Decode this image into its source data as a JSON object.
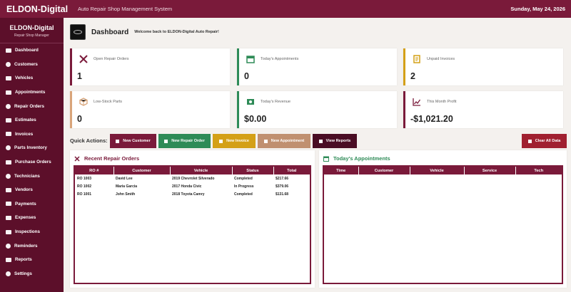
{
  "app": {
    "brand": "ELDON-Digital",
    "subtitle": "Auto Repair Shop Management System",
    "date": "Sunday, May 24, 2026"
  },
  "sidebar": {
    "title": "ELDON-Digital",
    "tagline": "Repair Shop Manager",
    "items": [
      {
        "label": "Dashboard",
        "icon": "dashboard-icon"
      },
      {
        "label": "Customers",
        "icon": "users-icon"
      },
      {
        "label": "Vehicles",
        "icon": "car-icon"
      },
      {
        "label": "Appointments",
        "icon": "calendar-icon"
      },
      {
        "label": "Repair Orders",
        "icon": "wrench-icon"
      },
      {
        "label": "Estimates",
        "icon": "calculator-icon"
      },
      {
        "label": "Invoices",
        "icon": "invoice-icon"
      },
      {
        "label": "Parts Inventory",
        "icon": "gear-icon"
      },
      {
        "label": "Purchase Orders",
        "icon": "cart-icon"
      },
      {
        "label": "Technicians",
        "icon": "technician-icon"
      },
      {
        "label": "Vendors",
        "icon": "truck-icon"
      },
      {
        "label": "Payments",
        "icon": "money-icon"
      },
      {
        "label": "Expenses",
        "icon": "receipt-icon"
      },
      {
        "label": "Inspections",
        "icon": "clipboard-icon"
      },
      {
        "label": "Reminders",
        "icon": "bell-icon"
      },
      {
        "label": "Reports",
        "icon": "chart-icon"
      },
      {
        "label": "Settings",
        "icon": "settings-icon"
      }
    ]
  },
  "dashboard": {
    "title": "Dashboard",
    "welcome": "Welcome back to ELDON-Digital Auto Repair!"
  },
  "cards": [
    {
      "label": "Open Repair Orders",
      "value": "1",
      "icon": "tools-icon",
      "color": "#7a1a3a"
    },
    {
      "label": "Today's Appointments",
      "value": "0",
      "icon": "calendar-icon",
      "color": "#2e8b57"
    },
    {
      "label": "Unpaid Invoices",
      "value": "2",
      "icon": "invoice-icon",
      "color": "#d4a017"
    },
    {
      "label": "Low-Stock Parts",
      "value": "0",
      "icon": "box-icon",
      "color": "#d9a57a"
    },
    {
      "label": "Today's Revenue",
      "value": "$0.00",
      "icon": "cash-icon",
      "color": "#2e8b57"
    },
    {
      "label": "This Month Profit",
      "value": "-$1,021.20",
      "icon": "chart-line-icon",
      "color": "#7a1a3a"
    }
  ],
  "quick_actions": {
    "label": "Quick Actions:",
    "buttons": [
      {
        "label": "New Customer",
        "color": "#7a1a3a"
      },
      {
        "label": "New Repair Order",
        "color": "#2e8b57"
      },
      {
        "label": "New Invoice",
        "color": "#d4a017"
      },
      {
        "label": "New Appointment",
        "color": "#c09070"
      },
      {
        "label": "View Reports",
        "color": "#4a0d24"
      }
    ],
    "clear_label": "Clear All Data",
    "clear_color": "#a02030"
  },
  "recent_orders": {
    "title": "Recent Repair Orders",
    "columns": [
      "RO #",
      "Customer",
      "Vehicle",
      "Status",
      "Total"
    ],
    "rows": [
      [
        "RO 1003",
        "David Lee",
        "2019 Chevrolet Silverado",
        "Completed",
        "$217.66"
      ],
      [
        "RO 1002",
        "Maria Garcia",
        "2017 Honda Civic",
        "In Progress",
        "$379.06"
      ],
      [
        "RO 1001",
        "John Smith",
        "2018 Toyota Camry",
        "Completed",
        "$131.68"
      ]
    ]
  },
  "appointments": {
    "title": "Today's Appointments",
    "columns": [
      "Time",
      "Customer",
      "Vehicle",
      "Service",
      "Tech"
    ]
  }
}
